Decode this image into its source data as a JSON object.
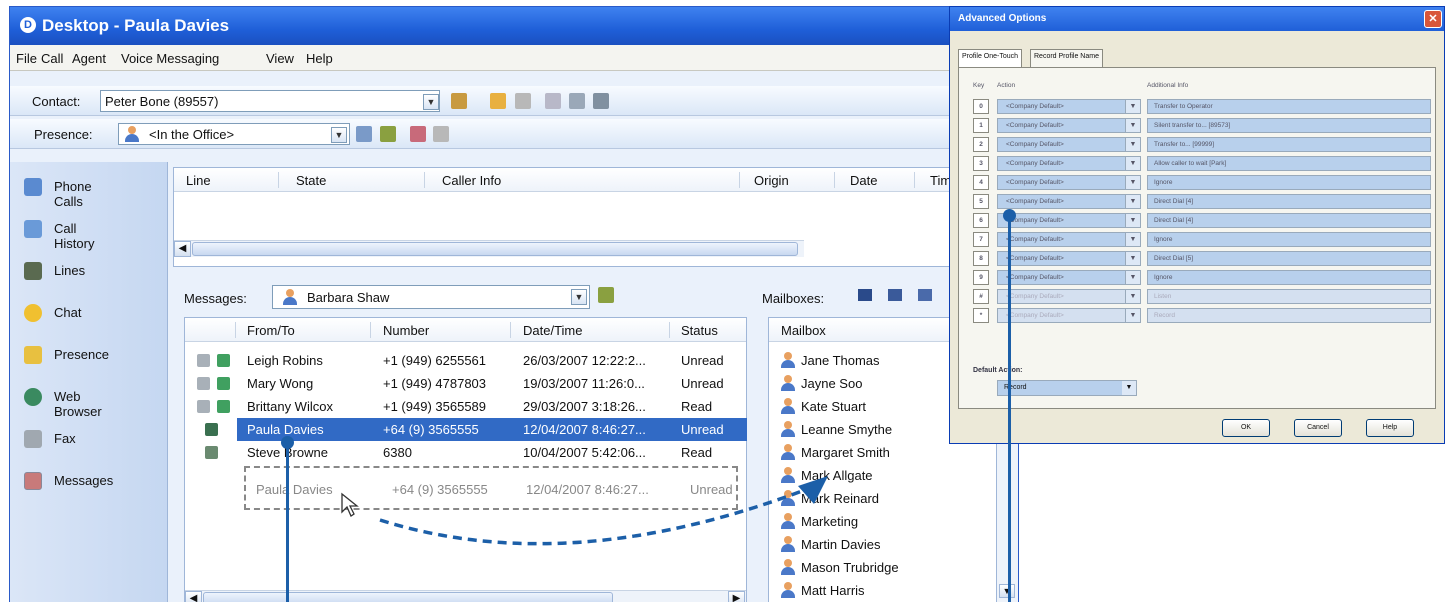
{
  "window": {
    "title": "Desktop - Paula Davies"
  },
  "menu": [
    "File",
    "Call",
    "Agent",
    "Voice Messaging",
    "View",
    "Help"
  ],
  "contact_bar": {
    "label": "Contact:",
    "value": "Peter Bone (89557)"
  },
  "presence_bar": {
    "label": "Presence:",
    "value": "<In the Office>"
  },
  "sidebar": {
    "items": [
      {
        "label": "Phone Calls",
        "icon": "phone-icon"
      },
      {
        "label": "Call History",
        "icon": "history-icon"
      },
      {
        "label": "Lines",
        "icon": "lines-icon"
      },
      {
        "label": "Chat",
        "icon": "chat-icon"
      },
      {
        "label": "Presence",
        "icon": "presence-icon"
      },
      {
        "label": "Web Browser",
        "icon": "globe-icon"
      },
      {
        "label": "Fax",
        "icon": "fax-icon"
      },
      {
        "label": "Messages",
        "icon": "messages-icon"
      }
    ]
  },
  "calls": {
    "columns": [
      "Line",
      "State",
      "Caller Info",
      "Origin",
      "Date",
      "Tim"
    ]
  },
  "messages": {
    "label": "Messages:",
    "selected_user": "Barbara Shaw",
    "columns": [
      "From/To",
      "Number",
      "Date/Time",
      "Status"
    ],
    "rows": [
      {
        "from": "Leigh Robins",
        "number": "+1 (949) 6255561",
        "datetime": "26/03/2007 12:22:2...",
        "status": "Unread"
      },
      {
        "from": "Mary Wong",
        "number": "+1 (949) 4787803",
        "datetime": "19/03/2007 11:26:0...",
        "status": "Unread"
      },
      {
        "from": "Brittany Wilcox",
        "number": "+1 (949) 3565589",
        "datetime": "29/03/2007 3:18:26...",
        "status": "Read"
      },
      {
        "from": "Paula Davies",
        "number": "+64 (9) 3565555",
        "datetime": "12/04/2007 8:46:27...",
        "status": "Unread"
      },
      {
        "from": "Steve Browne",
        "number": "6380",
        "datetime": "10/04/2007 5:42:06...",
        "status": "Read"
      }
    ],
    "drag_ghost": {
      "from": "Paula Davies",
      "number": "+64 (9) 3565555",
      "datetime": "12/04/2007 8:46:27...",
      "status": "Unread"
    }
  },
  "mailboxes": {
    "label": "Mailboxes:",
    "column": "Mailbox",
    "items": [
      "Jane Thomas",
      "Jayne Soo",
      "Kate Stuart",
      "Leanne Smythe",
      "Margaret Smith",
      "Mark Allgate",
      "Mark Reinard",
      "Marketing",
      "Martin Davies",
      "Mason Trubridge",
      "Matt Harris"
    ]
  },
  "dialog": {
    "title": "Advanced Options",
    "tabs": [
      "Profile One-Touch",
      "Record Profile Name"
    ],
    "headers": {
      "key": "Key",
      "action": "Action",
      "info": "Additional Info"
    },
    "rows": [
      {
        "key": "0",
        "action": "<Company Default>",
        "info": "Transfer to Operator"
      },
      {
        "key": "1",
        "action": "<Company Default>",
        "info": "Silent transfer to... [89573]"
      },
      {
        "key": "2",
        "action": "<Company Default>",
        "info": "Transfer to... [99999]"
      },
      {
        "key": "3",
        "action": "<Company Default>",
        "info": "Allow caller to wait [Park]"
      },
      {
        "key": "4",
        "action": "<Company Default>",
        "info": "Ignore"
      },
      {
        "key": "5",
        "action": "<Company Default>",
        "info": "Direct Dial [4]"
      },
      {
        "key": "6",
        "action": "<Company Default>",
        "info": "Direct Dial [4]"
      },
      {
        "key": "7",
        "action": "<Company Default>",
        "info": "Ignore"
      },
      {
        "key": "8",
        "action": "<Company Default>",
        "info": "Direct Dial [5]"
      },
      {
        "key": "9",
        "action": "<Company Default>",
        "info": "Ignore"
      },
      {
        "key": "#",
        "action": "<Company Default>",
        "info": "Listen"
      },
      {
        "key": "*",
        "action": "<Company Default>",
        "info": "Record"
      }
    ],
    "default_action_label": "Default Action:",
    "default_action_value": "Record",
    "buttons": {
      "ok": "OK",
      "cancel": "Cancel",
      "help": "Help"
    }
  },
  "colors": {
    "titlebar": "#1f5fd8",
    "selection": "#316ac5",
    "callout": "#1c5fa8",
    "dialog_close": "#d8563a"
  }
}
